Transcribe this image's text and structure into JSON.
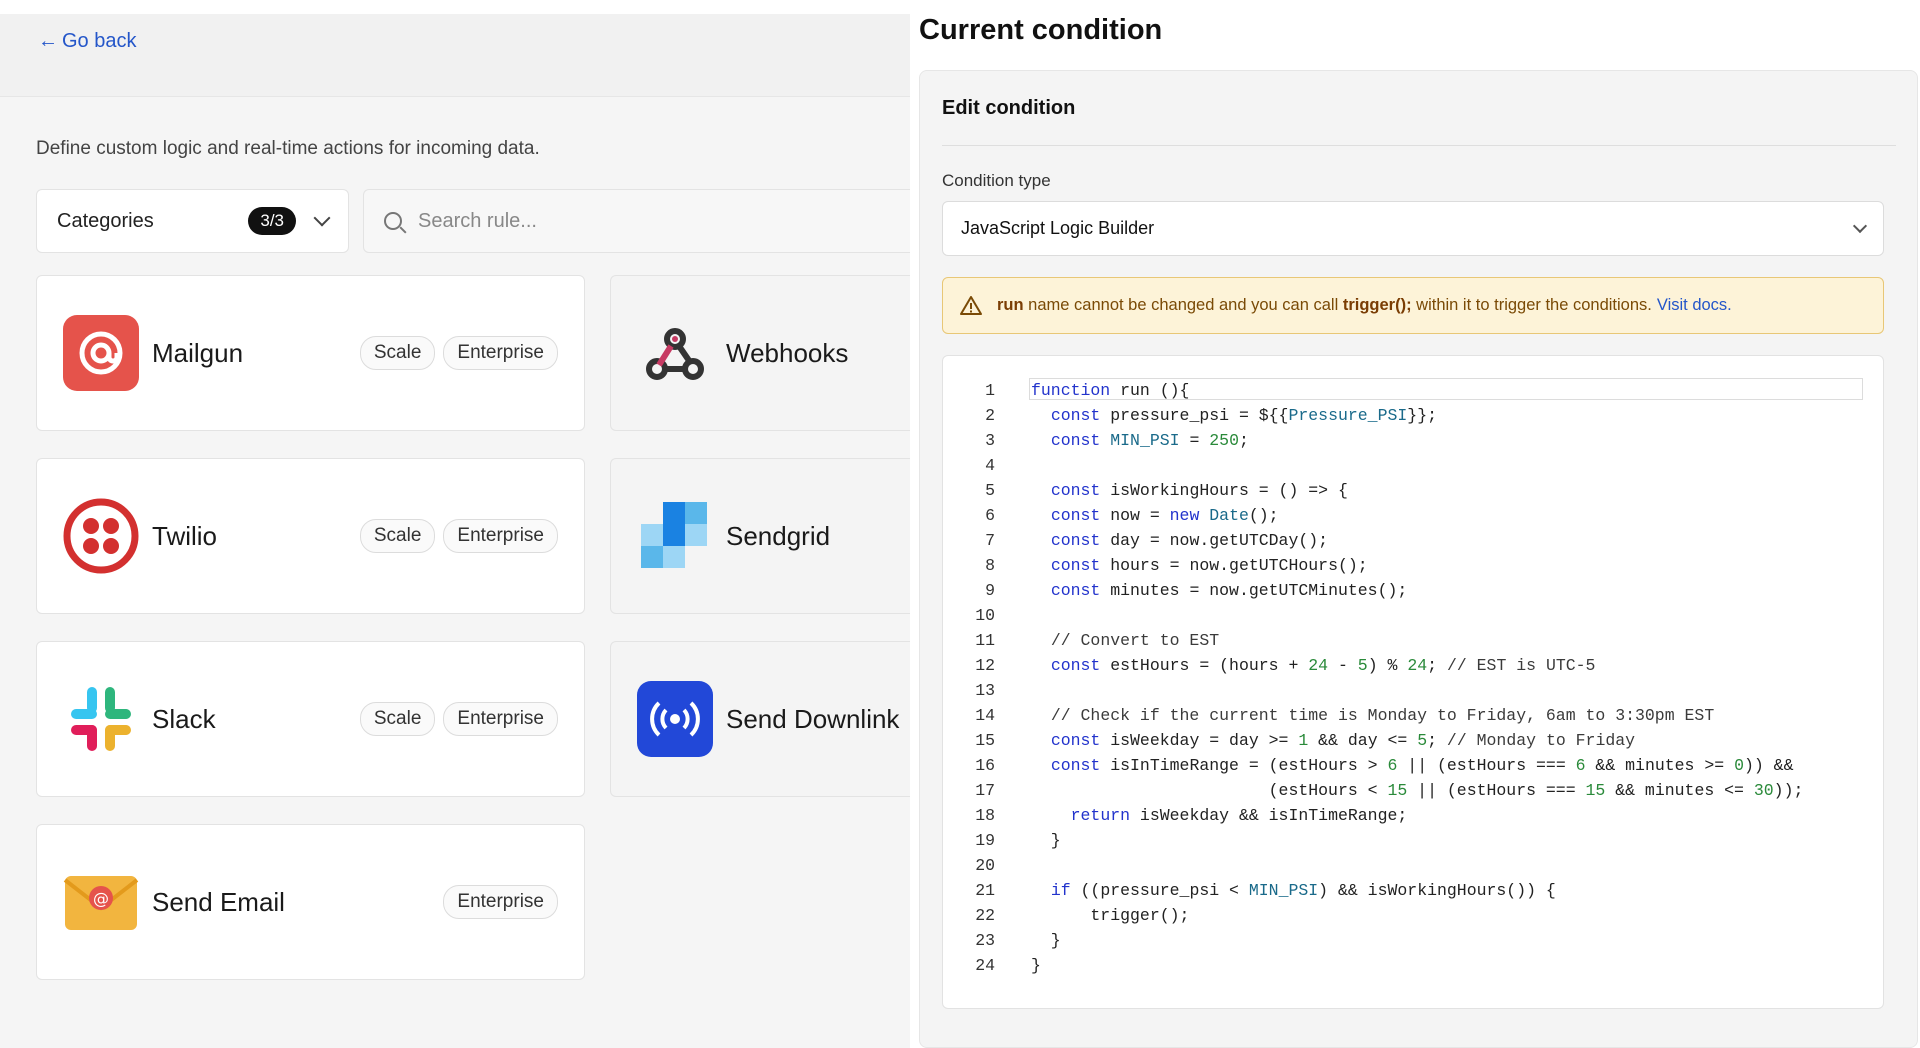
{
  "nav": {
    "back_label": "Go back"
  },
  "page": {
    "description": "Define custom logic and real-time actions for incoming data."
  },
  "filters": {
    "categories_label": "Categories",
    "categories_count": "3/3",
    "search_placeholder": "Search rule..."
  },
  "cards": [
    {
      "name": "Mailgun",
      "tags": [
        "Scale",
        "Enterprise"
      ],
      "icon": "mailgun-icon",
      "color": "#e5534b"
    },
    {
      "name": "Webhooks",
      "tags": [],
      "icon": "webhooks-icon",
      "color": "#c73a63"
    },
    {
      "name": "Twilio",
      "tags": [
        "Scale",
        "Enterprise"
      ],
      "icon": "twilio-icon",
      "color": "#d3302f"
    },
    {
      "name": "Sendgrid",
      "tags": [],
      "icon": "sendgrid-icon",
      "color": "#1a82e2"
    },
    {
      "name": "Slack",
      "tags": [
        "Scale",
        "Enterprise"
      ],
      "icon": "slack-icon",
      "color": "#4a154b"
    },
    {
      "name": "Send Downlink",
      "tags": [],
      "icon": "downlink-icon",
      "color": "#2248d8"
    },
    {
      "name": "Send Email",
      "tags": [
        "Enterprise"
      ],
      "icon": "email-icon",
      "color": "#f2b53f"
    }
  ],
  "panel": {
    "title": "Current condition",
    "edit_heading": "Edit condition",
    "condition_type_label": "Condition type",
    "condition_type_value": "JavaScript Logic Builder",
    "alert": {
      "strong1": "run",
      "text1": " name cannot be changed and you can call ",
      "strong2": "trigger();",
      "text2": " within it to trigger the conditions.",
      "link": "Visit docs."
    }
  },
  "code": {
    "lines": [
      "function run (){",
      "  const pressure_psi = ${{Pressure_PSI}};",
      "  const MIN_PSI = 250;",
      "",
      "  const isWorkingHours = () => {",
      "  const now = new Date();",
      "  const day = now.getUTCDay();",
      "  const hours = now.getUTCHours();",
      "  const minutes = now.getUTCMinutes();",
      "",
      "  // Convert to EST",
      "  const estHours = (hours + 24 - 5) % 24; // EST is UTC-5",
      "",
      "  // Check if the current time is Monday to Friday, 6am to 3:30pm EST",
      "  const isWeekday = day >= 1 && day <= 5; // Monday to Friday",
      "  const isInTimeRange = (estHours > 6 || (estHours === 6 && minutes >= 0)) &&",
      "                        (estHours < 15 || (estHours === 15 && minutes <= 30));",
      "    return isWeekday && isInTimeRange;",
      "  }",
      "",
      "  if ((pressure_psi < MIN_PSI) && isWorkingHours()) {",
      "      trigger();",
      "  }",
      "}"
    ]
  }
}
